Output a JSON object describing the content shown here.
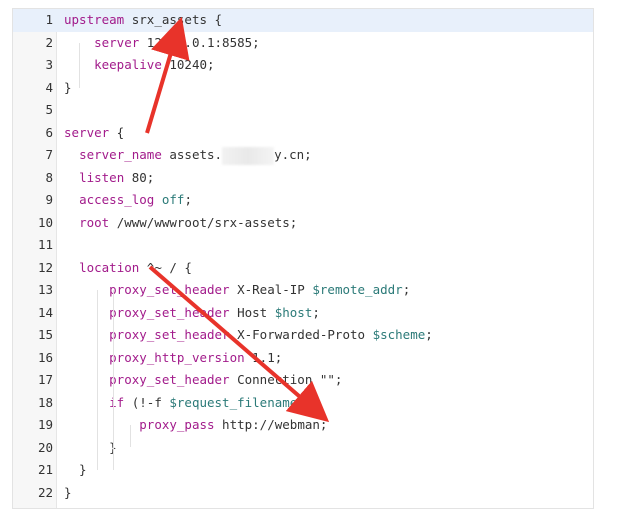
{
  "editor": {
    "lines": [
      {
        "n": "1",
        "parts": [
          {
            "t": "upstream",
            "c": "kw"
          },
          {
            "t": " srx_assets {",
            "c": ""
          }
        ]
      },
      {
        "n": "2",
        "parts": [
          {
            "t": "    ",
            "c": ""
          },
          {
            "t": "server",
            "c": "dir"
          },
          {
            "t": " 127.0.0.1:8585;",
            "c": ""
          }
        ]
      },
      {
        "n": "3",
        "parts": [
          {
            "t": "    ",
            "c": ""
          },
          {
            "t": "keepalive",
            "c": "dir"
          },
          {
            "t": " 10240;",
            "c": ""
          }
        ]
      },
      {
        "n": "4",
        "parts": [
          {
            "t": "}",
            "c": ""
          }
        ]
      },
      {
        "n": "5",
        "parts": []
      },
      {
        "n": "6",
        "parts": [
          {
            "t": "server",
            "c": "kw"
          },
          {
            "t": " {",
            "c": ""
          }
        ]
      },
      {
        "n": "7",
        "parts": [
          {
            "t": "  ",
            "c": ""
          },
          {
            "t": "server_name",
            "c": "dir"
          },
          {
            "t": " assets.",
            "c": ""
          },
          {
            "t": "",
            "c": "blur"
          },
          {
            "t": "y.cn;",
            "c": ""
          }
        ]
      },
      {
        "n": "8",
        "parts": [
          {
            "t": "  ",
            "c": ""
          },
          {
            "t": "listen",
            "c": "dir"
          },
          {
            "t": " 80;",
            "c": ""
          }
        ]
      },
      {
        "n": "9",
        "parts": [
          {
            "t": "  ",
            "c": ""
          },
          {
            "t": "access_log",
            "c": "dir"
          },
          {
            "t": " ",
            "c": ""
          },
          {
            "t": "off",
            "c": "var"
          },
          {
            "t": ";",
            "c": ""
          }
        ]
      },
      {
        "n": "10",
        "parts": [
          {
            "t": "  ",
            "c": ""
          },
          {
            "t": "root",
            "c": "dir"
          },
          {
            "t": " /www/wwwroot/srx-assets;",
            "c": ""
          }
        ]
      },
      {
        "n": "11",
        "parts": []
      },
      {
        "n": "12",
        "parts": [
          {
            "t": "  ",
            "c": ""
          },
          {
            "t": "location",
            "c": "kw"
          },
          {
            "t": " ^~ / {",
            "c": ""
          }
        ]
      },
      {
        "n": "13",
        "parts": [
          {
            "t": "      ",
            "c": ""
          },
          {
            "t": "proxy_set_header",
            "c": "dir"
          },
          {
            "t": " X-Real-IP ",
            "c": ""
          },
          {
            "t": "$remote_addr",
            "c": "var"
          },
          {
            "t": ";",
            "c": ""
          }
        ]
      },
      {
        "n": "14",
        "parts": [
          {
            "t": "      ",
            "c": ""
          },
          {
            "t": "proxy_set_header",
            "c": "dir"
          },
          {
            "t": " Host ",
            "c": ""
          },
          {
            "t": "$host",
            "c": "var"
          },
          {
            "t": ";",
            "c": ""
          }
        ]
      },
      {
        "n": "15",
        "parts": [
          {
            "t": "      ",
            "c": ""
          },
          {
            "t": "proxy_set_header",
            "c": "dir"
          },
          {
            "t": " X-Forwarded-Proto ",
            "c": ""
          },
          {
            "t": "$scheme",
            "c": "var"
          },
          {
            "t": ";",
            "c": ""
          }
        ]
      },
      {
        "n": "16",
        "parts": [
          {
            "t": "      ",
            "c": ""
          },
          {
            "t": "proxy_http_version",
            "c": "dir"
          },
          {
            "t": " 1.1;",
            "c": ""
          }
        ]
      },
      {
        "n": "17",
        "parts": [
          {
            "t": "      ",
            "c": ""
          },
          {
            "t": "proxy_set_header",
            "c": "dir"
          },
          {
            "t": " Connection \"\";",
            "c": ""
          }
        ]
      },
      {
        "n": "18",
        "parts": [
          {
            "t": "      ",
            "c": ""
          },
          {
            "t": "if",
            "c": "kw"
          },
          {
            "t": " (!-f ",
            "c": ""
          },
          {
            "t": "$request_filename",
            "c": "var"
          },
          {
            "t": "){",
            "c": ""
          }
        ]
      },
      {
        "n": "19",
        "parts": [
          {
            "t": "          ",
            "c": ""
          },
          {
            "t": "proxy_pass",
            "c": "dir"
          },
          {
            "t": " http://webman;",
            "c": ""
          }
        ]
      },
      {
        "n": "20",
        "parts": [
          {
            "t": "      }",
            "c": ""
          }
        ]
      },
      {
        "n": "21",
        "parts": [
          {
            "t": "  }",
            "c": ""
          }
        ]
      },
      {
        "n": "22",
        "parts": [
          {
            "t": "}",
            "c": ""
          }
        ]
      }
    ],
    "active_line": "1"
  },
  "annotations": {
    "arrow_color": "#e8332a",
    "arrows": [
      {
        "name": "upstream-arrow"
      },
      {
        "name": "proxy-pass-arrow"
      }
    ]
  }
}
